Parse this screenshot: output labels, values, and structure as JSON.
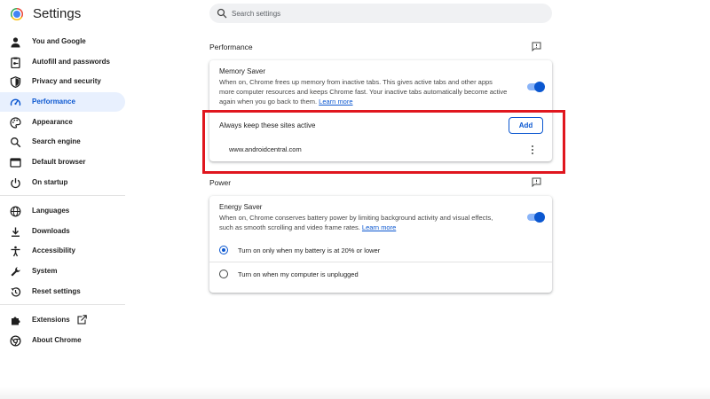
{
  "app": {
    "title": "Settings"
  },
  "search": {
    "placeholder": "Search settings"
  },
  "sidebar": {
    "items": [
      {
        "label": "You and Google",
        "icon": "person-icon"
      },
      {
        "label": "Autofill and passwords",
        "icon": "clipboard-key-icon"
      },
      {
        "label": "Privacy and security",
        "icon": "shield-icon"
      },
      {
        "label": "Performance",
        "icon": "speedometer-icon",
        "active": true
      },
      {
        "label": "Appearance",
        "icon": "palette-icon"
      },
      {
        "label": "Search engine",
        "icon": "search-icon"
      },
      {
        "label": "Default browser",
        "icon": "browser-window-icon"
      },
      {
        "label": "On startup",
        "icon": "power-icon"
      },
      {
        "label": "Languages",
        "icon": "globe-icon"
      },
      {
        "label": "Downloads",
        "icon": "download-icon"
      },
      {
        "label": "Accessibility",
        "icon": "accessibility-icon"
      },
      {
        "label": "System",
        "icon": "wrench-icon"
      },
      {
        "label": "Reset settings",
        "icon": "reset-history-icon"
      },
      {
        "label": "Extensions",
        "icon": "puzzle-icon",
        "trailing_icon": "external-link-icon"
      },
      {
        "label": "About Chrome",
        "icon": "chrome-icon"
      }
    ]
  },
  "performance": {
    "section_title": "Performance",
    "memory_saver": {
      "title": "Memory Saver",
      "description": "When on, Chrome frees up memory from inactive tabs. This gives active tabs and other apps more computer resources and keeps Chrome fast. Your inactive tabs automatically become active again when you go back to them.",
      "link": "Learn more",
      "enabled": true
    },
    "always_active": {
      "title": "Always keep these sites active",
      "add_label": "Add",
      "sites": [
        "www.androidcentral.com"
      ]
    }
  },
  "power": {
    "section_title": "Power",
    "energy_saver": {
      "title": "Energy Saver",
      "description": "When on, Chrome conserves battery power by limiting background activity and visual effects, such as smooth scrolling and video frame rates.",
      "link": "Learn more",
      "enabled": true,
      "options": [
        {
          "label": "Turn on only when my battery is at 20% or lower",
          "selected": true
        },
        {
          "label": "Turn on when my computer is unplugged",
          "selected": false
        }
      ]
    }
  },
  "colors": {
    "accent": "#0b57d0",
    "active_nav_bg": "#e8f0fe",
    "highlight_box": "#e0161e"
  }
}
